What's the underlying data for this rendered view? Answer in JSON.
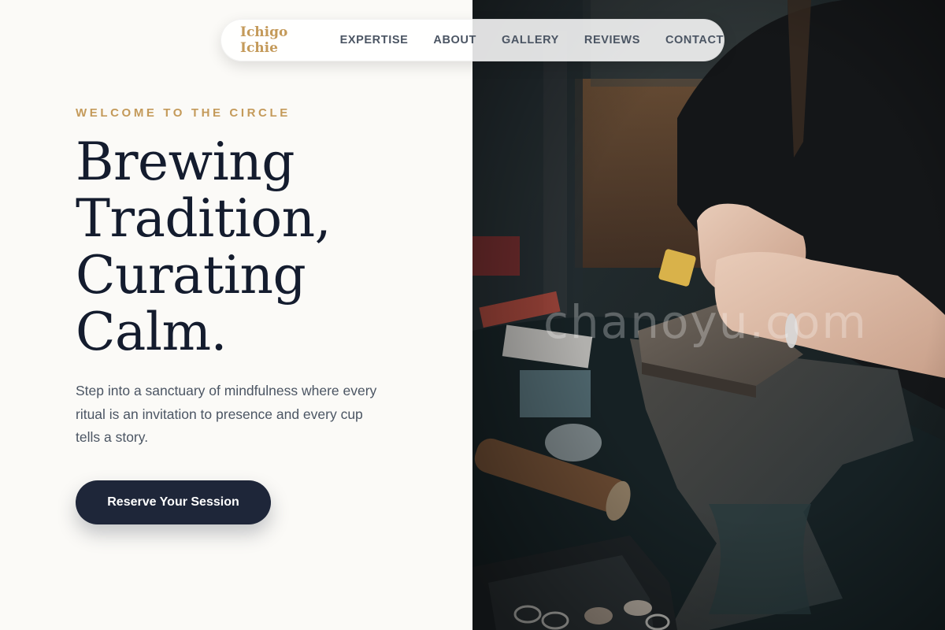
{
  "nav": {
    "brand": "Ichigo Ichie",
    "links": [
      {
        "label": "EXPERTISE"
      },
      {
        "label": "ABOUT"
      },
      {
        "label": "GALLERY"
      },
      {
        "label": "REVIEWS"
      },
      {
        "label": "CONTACT"
      }
    ]
  },
  "hero": {
    "eyebrow": "WELCOME TO THE CIRCLE",
    "headline_lines": [
      "Brewing",
      "Tradition,",
      "Curating",
      "Calm."
    ],
    "description": "Step into a sanctuary of mindfulness where every ritual is an invitation to presence and every cup tells a story.",
    "cta_label": "Reserve Your Session"
  },
  "photo": {
    "watermark": "chanoyu.com"
  },
  "colors": {
    "accent": "#c49a5a",
    "ink": "#141c2e",
    "button": "#1e2639",
    "background": "#fbfaf7"
  }
}
